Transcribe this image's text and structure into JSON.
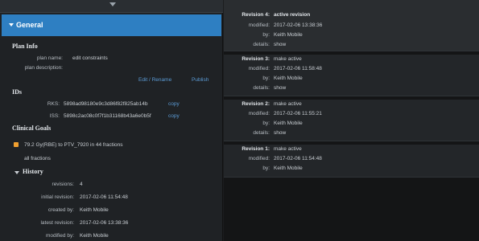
{
  "general": {
    "title": "General"
  },
  "plan_info": {
    "heading": "Plan Info",
    "plan_name_label": "plan name:",
    "plan_name_value": "edit constraints",
    "plan_description_label": "plan description:",
    "edit_rename": "Edit / Rename",
    "publish": "Publish"
  },
  "ids": {
    "heading": "IDs",
    "rks_label": "RKS:",
    "rks_value": "5898ad98180e9c3d86f82f825ab14b",
    "iss_label": "ISS:",
    "iss_value": "5898c2ac08c0f7f1b31168b43a6e0b5f",
    "copy": "copy"
  },
  "clinical_goals": {
    "heading": "Clinical Goals",
    "goal_text": "79.2 Gy(RBE) to PTV_7920 in 44 fractions",
    "fractions": "all fractions",
    "bullet_color": "#f0a030"
  },
  "history": {
    "heading": "History",
    "rows": [
      {
        "label": "revisions:",
        "value": "4"
      },
      {
        "label": "initial revision:",
        "value": "2017-02-06 11:54:48"
      },
      {
        "label": "created by:",
        "value": "Keith Mobile"
      },
      {
        "label": "latest revision:",
        "value": "2017-02-06 13:38:36"
      },
      {
        "label": "modified by:",
        "value": "Keith Mobile"
      }
    ]
  },
  "revisions": [
    {
      "head_label": "Revision 4:",
      "status": "active revision",
      "is_active": true,
      "modified_label": "modified:",
      "modified": "2017-02-06 13:38:36",
      "by_label": "by:",
      "by": "Keith Mobile",
      "details_label": "details:",
      "details": "show"
    },
    {
      "head_label": "Revision 3:",
      "status": "make active",
      "is_active": false,
      "modified_label": "modified:",
      "modified": "2017-02-06 11:58:48",
      "by_label": "by:",
      "by": "Keith Mobile",
      "details_label": "details:",
      "details": "show"
    },
    {
      "head_label": "Revision 2:",
      "status": "make active",
      "is_active": false,
      "modified_label": "modified:",
      "modified": "2017-02-06 11:55:21",
      "by_label": "by:",
      "by": "Keith Mobile",
      "details_label": "details:",
      "details": "show"
    },
    {
      "head_label": "Revision 1:",
      "status": "make active",
      "is_active": false,
      "modified_label": "modified:",
      "modified": "2017-02-06 11:54:48",
      "by_label": "by:",
      "by": "Keith Mobile"
    }
  ],
  "colors": {
    "accent": "#2e7fc2",
    "link": "#5b9bd5"
  }
}
